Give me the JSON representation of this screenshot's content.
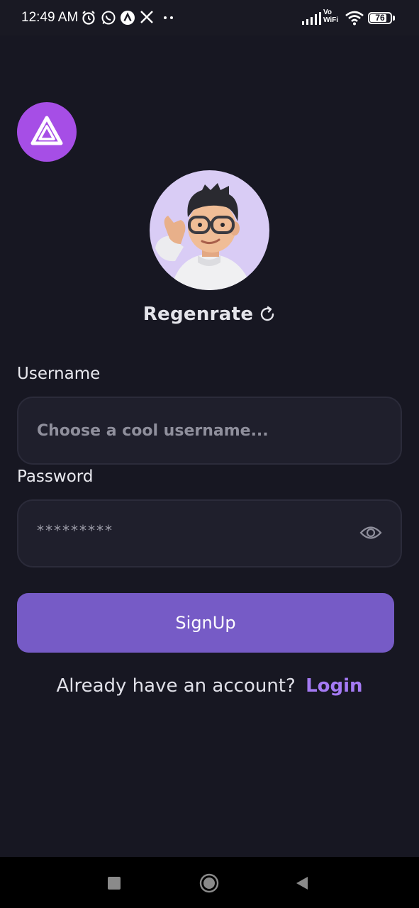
{
  "status_bar": {
    "time": "12:49 AM",
    "left_icons": [
      "alarm-icon",
      "whatsapp-icon",
      "app-icon",
      "x-icon",
      "more-dots-icon"
    ],
    "vowifi_line1": "Vo",
    "vowifi_line2": "WiFi",
    "battery": "76"
  },
  "app": {
    "logo_icon": "triangle-logo-icon",
    "accent_color": "#765bc6",
    "logo_color": "#a64ee6"
  },
  "avatar": {
    "regenerate_label": "Regenrate"
  },
  "form": {
    "username_label": "Username",
    "username_placeholder": "Choose a cool username...",
    "password_label": "Password",
    "password_value": "*********",
    "signup_label": "SignUp"
  },
  "footer": {
    "prompt": "Already have an account?",
    "login_label": "Login"
  }
}
